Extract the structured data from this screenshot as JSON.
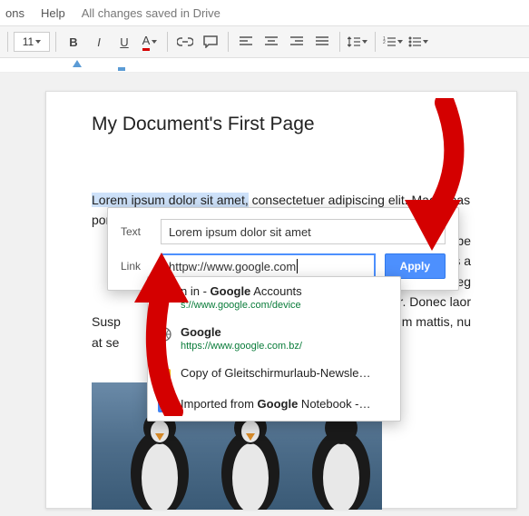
{
  "menubar": {
    "addons": "ons",
    "help": "Help",
    "status": "All changes saved in Drive"
  },
  "toolbar": {
    "fontsize": "11"
  },
  "document": {
    "title": "My Document's First Page",
    "highlighted": "Lorem ipsum dolor sit amet,",
    "body1_rest": " consectetuer adipiscing elit. Maecenas porttit",
    "body2": "alesuada libe",
    "body3": "est. Vivamus a",
    "body4": "es ac turpis eg",
    "body5": "or. Donec laor",
    "body_left1": "Susp",
    "body_left2": "at se",
    "body_right1": "ate vitae, pretium mattis, nu"
  },
  "dialog": {
    "text_label": "Text",
    "text_value": "Lorem ipsum dolor sit amet",
    "link_label": "Link",
    "link_value": "httpw://www.google.com",
    "apply": "Apply"
  },
  "suggestions": [
    {
      "title_pre": "n in - ",
      "title_bold": "Google",
      "title_post": " Accounts",
      "url": "s://www.google.com/device",
      "icon": "globe"
    },
    {
      "title_pre": "",
      "title_bold": "Google",
      "title_post": "",
      "url": "https://www.google.com.bz/",
      "icon": "globe"
    },
    {
      "title_pre": "Copy of Gleitschirmurlaub-Newsle…",
      "title_bold": "",
      "title_post": "",
      "url": "",
      "icon": "slides"
    },
    {
      "title_pre": "Imported from ",
      "title_bold": "Google",
      "title_post": " Notebook -…",
      "url": "",
      "icon": "docs"
    }
  ]
}
